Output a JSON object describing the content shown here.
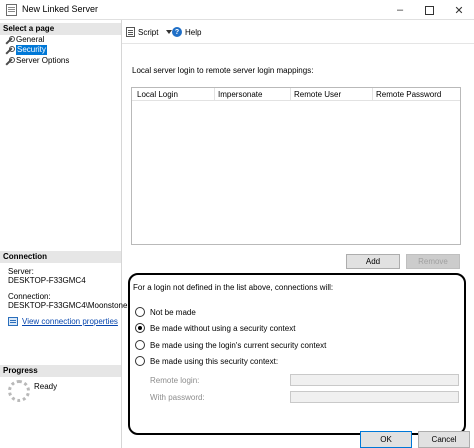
{
  "window": {
    "title": "New Linked Server",
    "min_glyph": "–",
    "close_glyph": "✕"
  },
  "sidebar": {
    "select_page_header": "Select a page",
    "pages": [
      {
        "label": "General",
        "icon": "wrench-icon"
      },
      {
        "label": "Security",
        "icon": "wrench-icon",
        "selected": true
      },
      {
        "label": "Server Options",
        "icon": "wrench-icon"
      }
    ],
    "connection_header": "Connection",
    "server_label": "Server:",
    "server_value": "DESKTOP-F33GMC4",
    "connection_label": "Connection:",
    "connection_value": "DESKTOP-F33GMC4\\Moonstone",
    "view_properties_link": "View connection properties",
    "progress_header": "Progress",
    "progress_status": "Ready"
  },
  "toolbar": {
    "script_label": "Script",
    "help_label": "Help",
    "help_glyph": "?"
  },
  "mappings": {
    "label": "Local server login to remote server login mappings:",
    "columns": [
      "Local Login",
      "Impersonate",
      "Remote User",
      "Remote Password"
    ],
    "rows": [],
    "add_button": "Add",
    "remove_button": "Remove"
  },
  "security": {
    "description": "For a login not defined in the list above, connections will:",
    "options": [
      {
        "label": "Not be made",
        "checked": false
      },
      {
        "label": "Be made without using a security context",
        "checked": true
      },
      {
        "label": "Be made using the login's current security context",
        "checked": false
      },
      {
        "label": "Be made using this security context:",
        "checked": false
      }
    ],
    "remote_login_label": "Remote login:",
    "remote_login_value": "",
    "password_label": "With password:",
    "password_value": ""
  },
  "footer": {
    "ok_button": "OK",
    "cancel_button": "Cancel"
  }
}
